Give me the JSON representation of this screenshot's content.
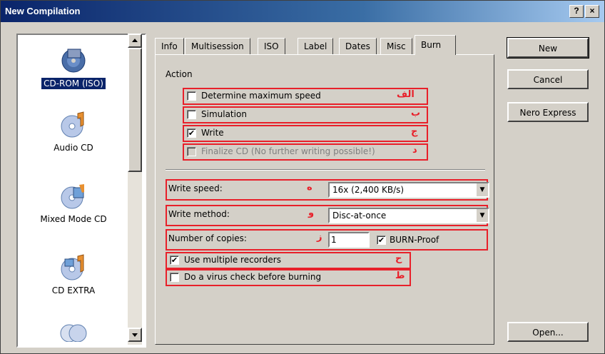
{
  "window": {
    "title": "New Compilation",
    "help_label": "?",
    "close_label": "×"
  },
  "left_list": {
    "items": [
      {
        "label": "CD-ROM (ISO)",
        "icon": "cd-rom-iso-icon",
        "selected": true
      },
      {
        "label": "Audio CD",
        "icon": "audio-cd-icon"
      },
      {
        "label": "Mixed Mode CD",
        "icon": "mixed-mode-cd-icon"
      },
      {
        "label": "CD EXTRA",
        "icon": "cd-extra-icon"
      },
      {
        "label": "",
        "icon": "copy-cd-icon"
      }
    ]
  },
  "tabs": [
    "Info",
    "Multisession",
    "ISO",
    "Label",
    "Dates",
    "Misc",
    "Burn"
  ],
  "active_tab": "Burn",
  "burn": {
    "action_label": "Action",
    "determine_max_speed": {
      "label": "Determine maximum speed",
      "checked": false,
      "tag": "الف"
    },
    "simulation": {
      "label": "Simulation",
      "checked": false,
      "tag": "ب"
    },
    "write": {
      "label": "Write",
      "checked": true,
      "tag": "ج"
    },
    "finalize": {
      "label": "Finalize CD (No further writing possible!)",
      "checked": false,
      "disabled": true,
      "tag": "د"
    },
    "write_speed": {
      "label": "Write speed:",
      "value": "16x (2,400 KB/s)",
      "tag": "ه"
    },
    "write_method": {
      "label": "Write method:",
      "value": "Disc-at-once",
      "tag": "و"
    },
    "copies": {
      "label": "Number of copies:",
      "value": "1",
      "tag": "ز"
    },
    "burn_proof": {
      "label": "BURN-Proof",
      "checked": true
    },
    "multiple_recorders": {
      "label": "Use multiple recorders",
      "checked": true,
      "tag": "ح"
    },
    "virus_check": {
      "label": "Do a virus check before burning",
      "checked": false,
      "tag": "ط"
    }
  },
  "buttons": {
    "new": "New",
    "cancel": "Cancel",
    "nero_express": "Nero Express",
    "open": "Open..."
  },
  "colors": {
    "annotation_red": "#e8202a",
    "title_blue": "#0a246a"
  }
}
